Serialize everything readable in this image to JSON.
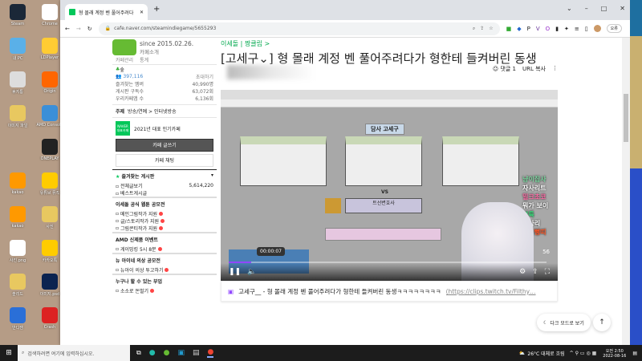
{
  "desktop": {
    "icons": [
      "Steam",
      "Chrome",
      "내 PC",
      "LDPlayer",
      "휴지통",
      "Origin",
      "이미지 파일",
      "AMD Console",
      "",
      "ONEPLAY",
      "kakao",
      "유튜브 뮤직",
      "kakao",
      "사진",
      "사진.png",
      "카카오톡",
      "솔리드",
      "이미지.psd",
      "반디캠",
      "Crash"
    ]
  },
  "browser": {
    "tab_title": "형 몰래 계정 벤 풀어주려다",
    "new_tab": "+",
    "url": "cafe.naver.com/steamindiegame/5655293",
    "profile": "오류"
  },
  "sidebar": {
    "since": "since 2015.02.26.",
    "cafe_intro": "카페소개",
    "cafe_manage": "카페관리",
    "stats": "통계",
    "level": "숲",
    "members": "397,116",
    "invite": "초대하기",
    "info": [
      {
        "label": "즐겨찾는 멤버",
        "value": "40,990명"
      },
      {
        "label": "게시판 구독수",
        "value": "63,072회"
      },
      {
        "label": "우리카페앱 수",
        "value": "6,136회"
      }
    ],
    "topic_label": "주제",
    "topic": "방송/연예 > 인터넷방송",
    "badge": "NAVER 대표카페",
    "badge_text": "2021년 대표 인기카페",
    "write": "카페 글쓰기",
    "chat": "카페 채팅",
    "fav_boards": "즐겨찾는 게시판",
    "all_posts": "전체글보기",
    "all_count": "5,614,220",
    "best": "베스트게시글",
    "sections": [
      {
        "title": "이세돌 공식 웹툰 공모전",
        "items": [
          "메인그림작가 지원",
          "글/스토리작가 지원",
          "그림콘티작가 지원"
        ]
      },
      {
        "title": "AMD 신제품 이벤트",
        "items": [
          "게이밍킹 5시 8분"
        ]
      },
      {
        "title": "뉴 아이네 의상 공모전",
        "items": [
          "뉴아이 의상 투고하기"
        ]
      },
      {
        "title": "누구나 할 수 있는 부업",
        "items": [
          "소소로 돈벌기"
        ]
      }
    ]
  },
  "article": {
    "breadcrumb": "이세돌 | 짱클립 >",
    "title": "[고세구⌄] 형 몰래 계정 벤 풀어주려다가 형한테 들켜버린 동생",
    "comments": "댓글 1",
    "url_copy": "URL 복사",
    "video": {
      "sheet_title": "담사 고세구",
      "vs": "VS",
      "center": "트선변호사",
      "time": "00:00:07",
      "progress": 0.07,
      "counter": "56",
      "chat": [
        "냥이집사",
        "자사리트",
        "밀크초코",
        "뭐가 보이",
        "정륙",
        "자사리",
        "사이뻥띠"
      ]
    },
    "caption": "고세구__ - 형 몰래 계정 벤 풀어주려다가 형한테 들켜버린 동생ㅋㅋㅋㅋㅋㅋㅋㅋ",
    "caption_link": "(https://clips.twitch.tv/Filthy…"
  },
  "floating": {
    "dark_mode": "다크 모드로 보기"
  },
  "taskbar": {
    "search": "검색하려면 여기에 입력하십시오.",
    "weather": "26°C 대체로 흐림",
    "time": "오전 2:50",
    "date": "2022-08-16"
  }
}
